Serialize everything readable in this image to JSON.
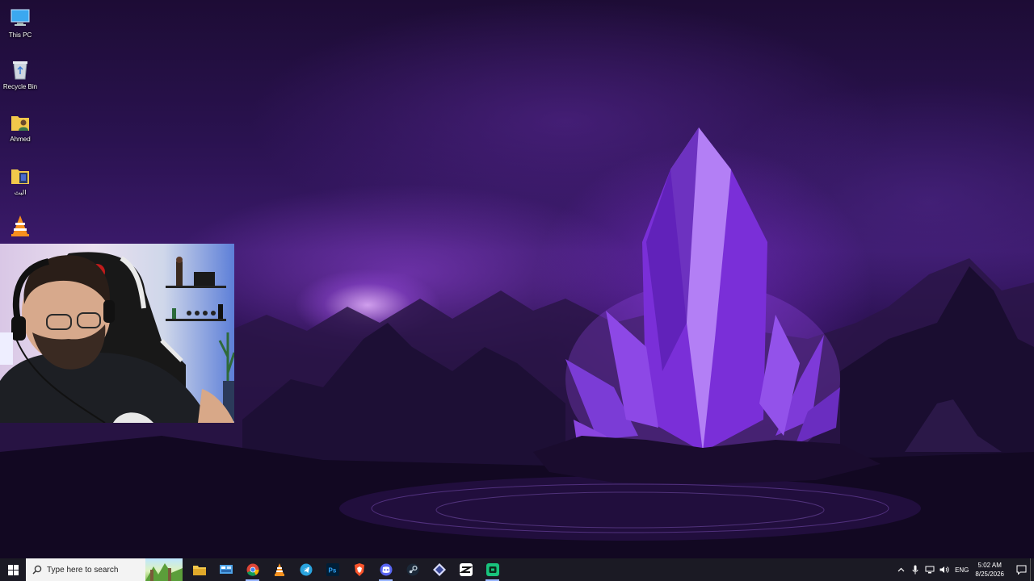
{
  "desktop": {
    "icons": [
      {
        "label": "This PC",
        "icon": "this-pc-icon"
      },
      {
        "label": "Recycle Bin",
        "icon": "recycle-bin-icon"
      },
      {
        "label": "Ahmed",
        "icon": "user-folder-icon"
      },
      {
        "label": "البث",
        "icon": "folder-icon"
      },
      {
        "label": "",
        "icon": "vlc-icon"
      }
    ]
  },
  "taskbar": {
    "search_placeholder": "Type here to search",
    "pinned": [
      {
        "icon": "file-explorer-icon",
        "active": false
      },
      {
        "icon": "control-panel-icon",
        "active": false
      },
      {
        "icon": "chrome-icon",
        "active": true
      },
      {
        "icon": "vlc-media-player-icon",
        "active": false
      },
      {
        "icon": "telegram-icon",
        "active": false
      },
      {
        "icon": "photoshop-icon",
        "active": false
      },
      {
        "icon": "brave-icon",
        "active": false
      },
      {
        "icon": "discord-icon",
        "active": true
      },
      {
        "icon": "steam-icon",
        "active": false
      },
      {
        "icon": "gitkraken-icon",
        "active": false
      },
      {
        "icon": "capcut-icon",
        "active": false
      },
      {
        "icon": "streaming-app-icon",
        "active": true
      }
    ],
    "tray": {
      "language": "ENG",
      "time": "5:02 AM",
      "date": "8/25/2026"
    }
  }
}
